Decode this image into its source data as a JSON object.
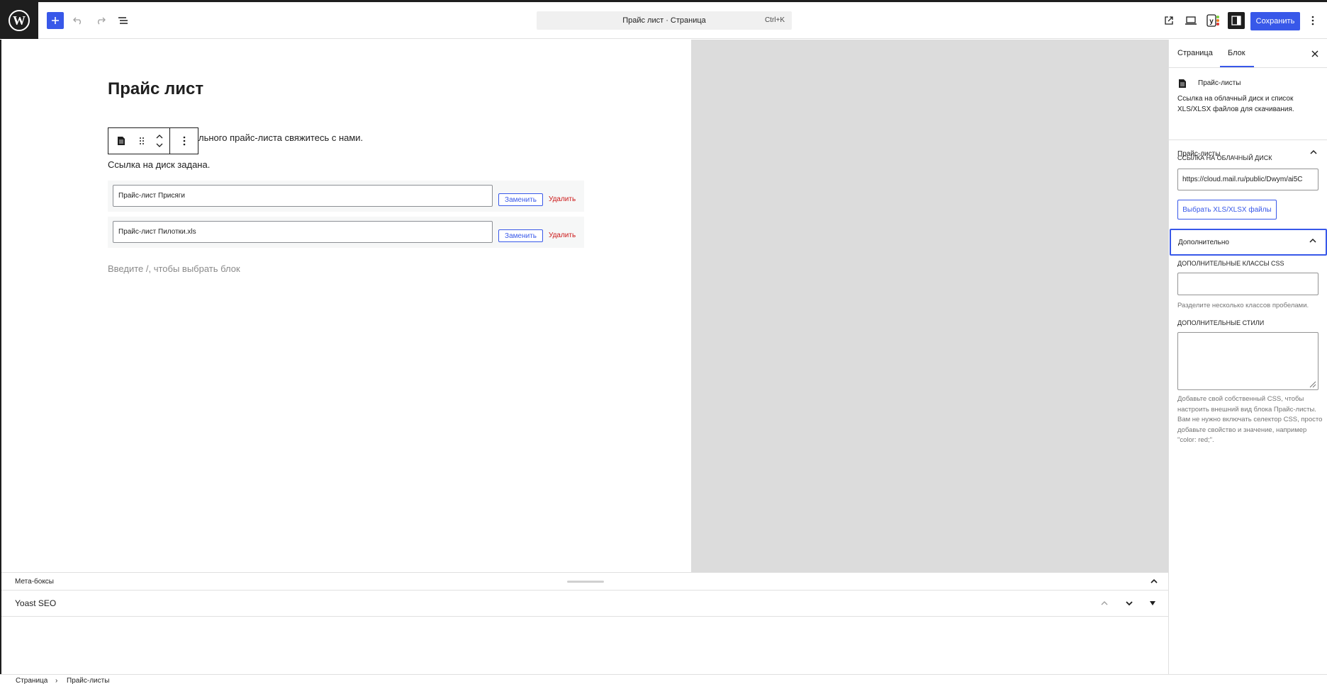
{
  "header": {
    "command_bar": {
      "title": "Прайс лист · Страница",
      "shortcut": "Ctrl+K"
    },
    "save_label": "Сохранить"
  },
  "editor": {
    "page_title": "Прайс лист",
    "paragraph_1_visible": "льного прайс-листа свяжитесь с нами.",
    "paragraph_2": "Ссылка на диск задана.",
    "files": [
      {
        "name": "Прайс-лист Присяги",
        "replace_label": "Заменить",
        "delete_label": "Удалить"
      },
      {
        "name": "Прайс-лист Пилотки.xls",
        "replace_label": "Заменить",
        "delete_label": "Удалить"
      }
    ],
    "empty_block_placeholder": "Введите /, чтобы выбрать блок"
  },
  "meta_boxes": {
    "label": "Мета-боксы",
    "yoast_label": "Yoast SEO"
  },
  "breadcrumb": {
    "items": [
      "Страница",
      "Прайс-листы"
    ]
  },
  "sidebar": {
    "tabs": [
      "Страница",
      "Блок"
    ],
    "active_tab": "Блок",
    "block": {
      "name": "Прайс-листы",
      "description": "Ссылка на облачный диск и список XLS/XLSX файлов для скачивания."
    },
    "panel_price_lists": {
      "title": "Прайс-листы",
      "cloud_label": "ССЫЛКА НА ОБЛАЧНЫЙ ДИСК",
      "cloud_value": "https://cloud.mail.ru/public/Dwym/ai5C",
      "choose_button": "Выбрать XLS/XLSX файлы"
    },
    "panel_advanced": {
      "title": "Дополнительно",
      "css_classes_label": "ДОПОЛНИТЕЛЬНЫЕ КЛАССЫ CSS",
      "css_classes_help": "Разделите несколько классов пробелами.",
      "styles_label": "ДОПОЛНИТЕЛЬНЫЕ СТИЛИ",
      "styles_help": "Добавьте свой собственный CSS, чтобы настроить внешний вид блока Прайс-листы. Вам не нужно включать селектор CSS, просто добавьте свойство и значение, например \"color: red;\"."
    }
  },
  "colors": {
    "accent": "#3858e9",
    "danger": "#cc1818",
    "canvas_gray": "#dcdcdc",
    "dark": "#1e1e1e"
  }
}
